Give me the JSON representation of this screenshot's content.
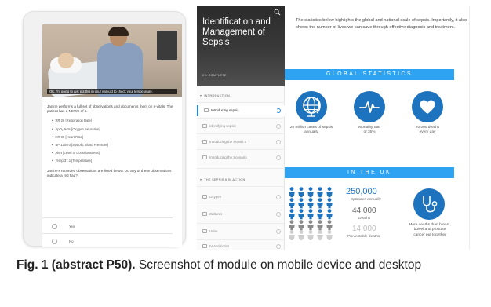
{
  "figure": {
    "label": "Fig. 1 (abstract P50).",
    "caption": "Screenshot of module on mobile device and desktop"
  },
  "tablet": {
    "video_caption": "OK, I'm going to just put this in your ear just to check your temperature.",
    "scenario_text": "Janine performs a full set of observations and documents them on e-vitals. The patient has a NEWS of 5.",
    "observations": [
      "RR 26 [Respiration Rate]",
      "SpO₂ 94% [Oxygen saturation]",
      "HR 98 [Heart Rate]",
      "BP 120/70 [Systolic Blood Pressure]",
      "Alert [Level of Consciousness]",
      "Temp 37.1 [Temperature]"
    ],
    "question": "Janine's recorded observations are listed below. Do any of these observations indicate a red flag?",
    "options": [
      "Yes",
      "No"
    ]
  },
  "sidebar": {
    "title": "Identification and Management of Sepsis",
    "progress_text": "0% COMPLETE",
    "sections": [
      {
        "heading": "INTRODUCTION",
        "items": [
          {
            "label": "Introducing sepsis",
            "active": true
          },
          {
            "label": "Identifying sepsis",
            "active": false
          },
          {
            "label": "Introducing the Sepsis 6",
            "active": false
          },
          {
            "label": "Introducing the Scenario",
            "active": false
          }
        ]
      },
      {
        "heading": "THE SEPSIS 6 IN ACTION",
        "items": [
          {
            "label": "Oxygen",
            "active": false
          },
          {
            "label": "Cultures",
            "active": false
          },
          {
            "label": "Urine",
            "active": false
          },
          {
            "label": "IV Antibiotics",
            "active": false
          }
        ]
      }
    ]
  },
  "content": {
    "intro": "The statistics below highlights the global and national scale of sepsis. Importantly, it also shows the number of lives we can save through effective diagnosis and treatment.",
    "global_bar": "GLOBAL STATISTICS",
    "global_stats": [
      {
        "icon": "globe-icon",
        "line1": "20 million cases of sepsis",
        "line2": "annually"
      },
      {
        "icon": "pulse-icon",
        "line1": "Mortality rate",
        "line2": "of 35%"
      },
      {
        "icon": "heart-icon",
        "line1": "20,000 deaths",
        "line2": "every day"
      }
    ],
    "uk_bar": "IN THE UK",
    "uk_stats": {
      "episodes_value": "250,000",
      "episodes_label": "Episodes annually",
      "deaths_value": "44,000",
      "deaths_label": "Deaths",
      "preventable_value": "14,000",
      "preventable_label": "Preventable deaths",
      "cancer_line1": "More deaths than breast,",
      "cancer_line2": "bowel and prostate",
      "cancer_line3": "cancer put together"
    },
    "colors": {
      "accent": "#2ea3f2",
      "circle": "#1e73be",
      "sidebar_header": "#2b2b2b"
    }
  }
}
